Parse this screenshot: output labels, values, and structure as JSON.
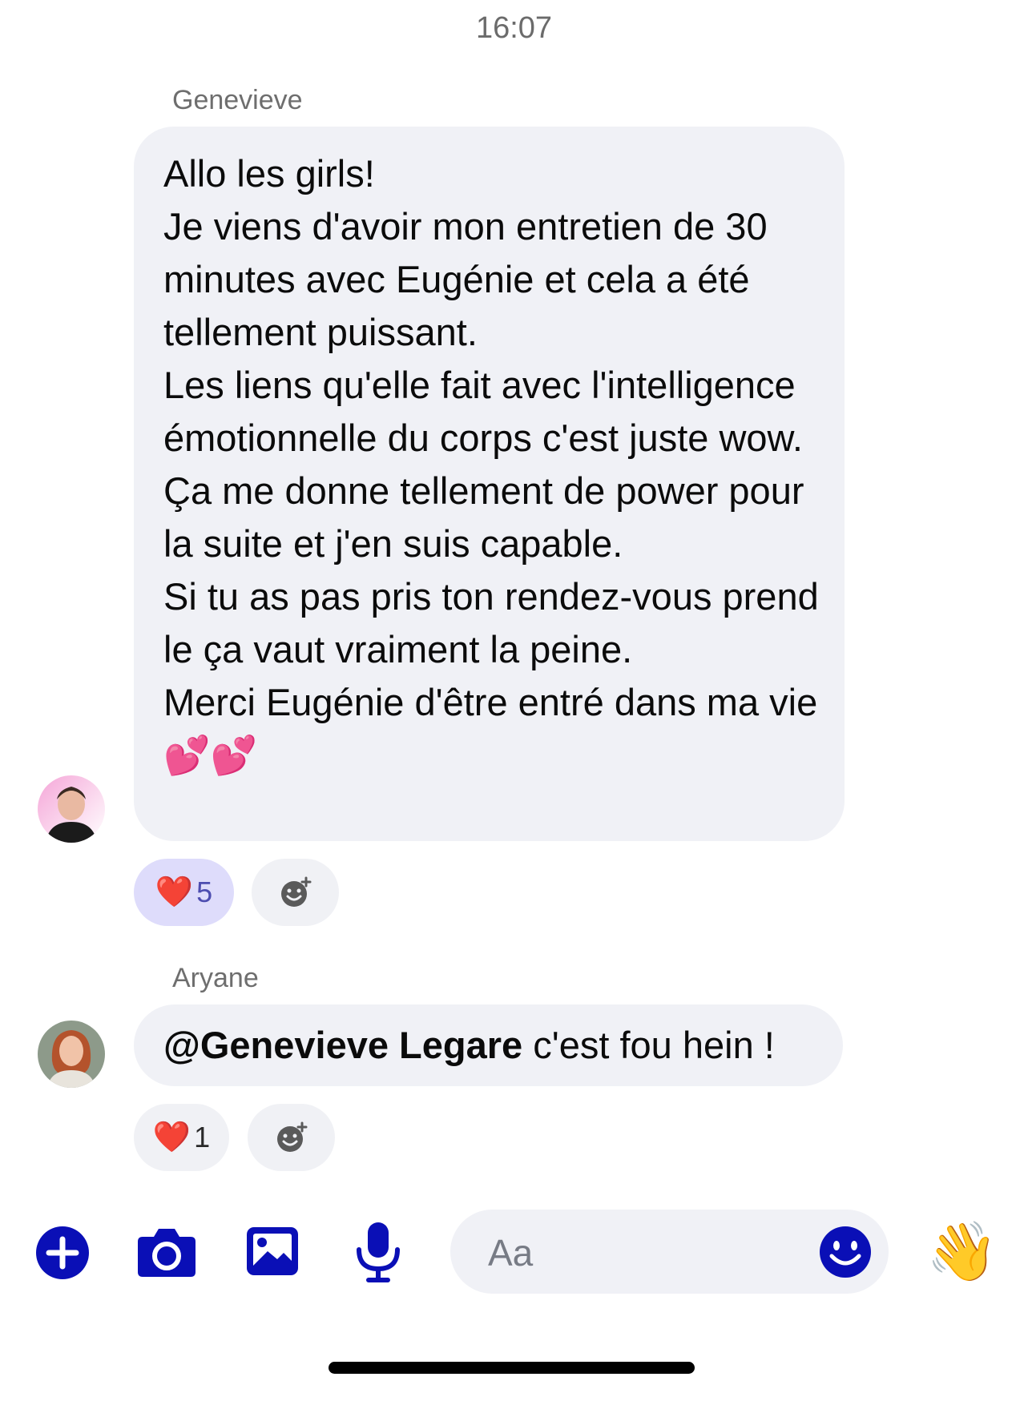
{
  "status": {
    "time": "16:07"
  },
  "messages": [
    {
      "sender": "Genevieve",
      "text": "Allo les girls!\nJe viens d'avoir mon entretien de 30 minutes avec Eugénie et cela a été tellement puissant.\nLes liens qu'elle fait avec l'intelligence émotionnelle du corps c'est juste wow. Ça me donne tellement de power pour la suite et j'en suis capable.\nSi tu as pas pris ton rendez-vous prend le ça vaut vraiment la peine.\nMerci Eugénie d'être entré dans ma vie 💕💕",
      "reaction": {
        "emoji": "❤️",
        "count": "5",
        "icon": "heart-icon",
        "highlighted": true
      }
    },
    {
      "sender": "Aryane",
      "mention": "@Genevieve Legare",
      "text": " c'est fou hein !",
      "reaction": {
        "emoji": "❤️",
        "count": "1",
        "icon": "heart-icon",
        "highlighted": false
      }
    }
  ],
  "composer": {
    "placeholder": "Aa"
  },
  "toolbar": {
    "icons": [
      "plus-icon",
      "camera-icon",
      "image-icon",
      "microphone-icon",
      "smiley-icon",
      "waving-hand-icon"
    ],
    "wave_emoji": "👋"
  },
  "colors": {
    "accent": "#0a0fb6",
    "bubble": "#f0f1f6",
    "reaction_highlight": "#dedcfb"
  }
}
